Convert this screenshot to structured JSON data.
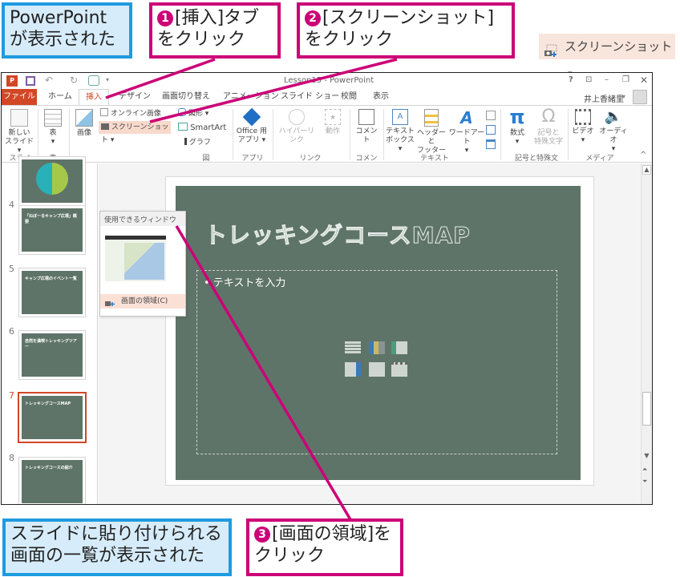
{
  "callouts": {
    "c1": {
      "line1": "PowerPoint",
      "line2": "が表示された"
    },
    "c2": {
      "num": "1",
      "line1": "[挿入]タブ",
      "line2": "をクリック"
    },
    "c3": {
      "num": "2",
      "line1": "[スクリーンショット]",
      "line2": "をクリック"
    },
    "c4": {
      "line1": "スライドに貼り付けられる",
      "line2": "画面の一覧が表示された"
    },
    "c5": {
      "num": "3",
      "line1": "[画面の領域]を",
      "line2": "クリック"
    }
  },
  "zoom_button": {
    "label": "スクリーンショット",
    "caret": "▾"
  },
  "window": {
    "title": "Lesson15 - PowerPoint",
    "controls": {
      "help": "?",
      "ribbon_opts": "⊡",
      "minimize": "–",
      "restore": "❐",
      "close": "✕"
    },
    "user": "井上香緒里",
    "user_caret": "▾"
  },
  "quick_access": {
    "undo": "↶",
    "redo": "↻",
    "more": "▾"
  },
  "tabs": [
    {
      "label": "ファイル"
    },
    {
      "label": "ホーム"
    },
    {
      "label": "挿入"
    },
    {
      "label": "デザイン"
    },
    {
      "label": "画面切り替え"
    },
    {
      "label": "アニメーション"
    },
    {
      "label": "スライド ショー"
    },
    {
      "label": "校閲"
    },
    {
      "label": "表示"
    }
  ],
  "ribbon": {
    "new_slide": {
      "line1": "新しい",
      "line2": "スライド ▾"
    },
    "table": {
      "line1": "表",
      "line2": "▾"
    },
    "image": "画像",
    "online_image": "オンライン画像",
    "screenshot": "スクリーンショット ▾",
    "shapes": "図形 ▾",
    "smartart": "SmartArt",
    "chart": "グラフ",
    "office_apps": {
      "line1": "Office 用",
      "line2": "アプリ ▾"
    },
    "hyperlink": "ハイパーリンク",
    "action": "動作",
    "comment": "コメント",
    "textbox": {
      "line1": "テキスト",
      "line2": "ボックス ▾"
    },
    "header_footer": {
      "line1": "ヘッダーと",
      "line2": "フッター"
    },
    "wordart": {
      "line1": "ワードアート",
      "line2": "▾"
    },
    "equation": {
      "line1": "数式",
      "line2": "▾"
    },
    "symbol": {
      "line1": "記号と",
      "line2": "特殊文字"
    },
    "video": {
      "line1": "ビデオ",
      "line2": "▾"
    },
    "audio": {
      "line1": "オーディオ",
      "line2": "▾"
    },
    "groups": {
      "slides": "スライド",
      "tables": "表",
      "images": "図",
      "apps": "アプリ",
      "links": "リンク",
      "comments": "コメント",
      "text": "テキスト",
      "symbols": "記号と特殊文字",
      "media": "メディア"
    },
    "collapse": "^"
  },
  "dropdown": {
    "header": "使用できるウィンドウ",
    "item": "画面の領域(C)"
  },
  "thumbnails": [
    {
      "num": "4",
      "title": "「ねぼーるキャンプ広場」概要",
      "selected": false
    },
    {
      "num": "5",
      "title": "キャンプ広場のイベント一覧",
      "selected": false
    },
    {
      "num": "6",
      "title": "自然を満喫トレッキングツアー",
      "selected": false
    },
    {
      "num": "7",
      "title": "トレッキングコースMAP",
      "selected": true
    },
    {
      "num": "8",
      "title": "トレッキングコースの紹介",
      "selected": false
    }
  ],
  "slide": {
    "title": "トレッキングコースMAP",
    "bullet": "• テキストを入力"
  },
  "colors": {
    "accent": "#d24726",
    "callout_pink": "#cc0077",
    "callout_blue": "#1e9be0",
    "slide_bg": "#5f7468"
  }
}
